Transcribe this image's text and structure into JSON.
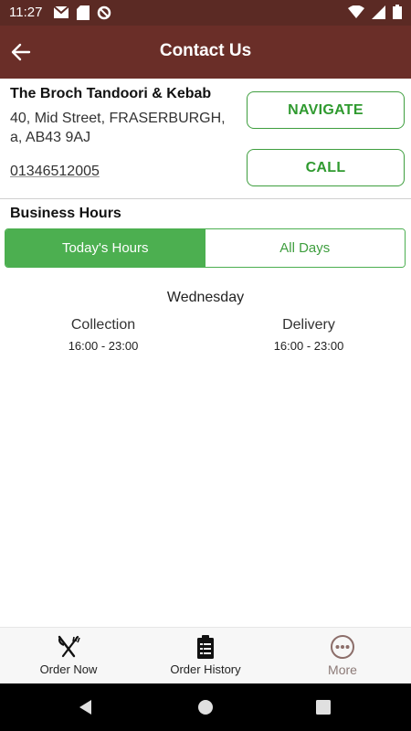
{
  "status_bar": {
    "time": "11:27"
  },
  "app_bar": {
    "title": "Contact Us"
  },
  "restaurant": {
    "name": "The Broch Tandoori & Kebab",
    "address_line1": "40, Mid Street, FRASERBURGH,",
    "address_line2": "a, AB43 9AJ",
    "phone": "01346512005"
  },
  "actions": {
    "navigate": "NAVIGATE",
    "call": "CALL"
  },
  "hours": {
    "heading": "Business Hours",
    "tabs": [
      "Today's Hours",
      "All Days"
    ],
    "day": "Wednesday",
    "collection_label": "Collection",
    "collection_hours": "16:00 - 23:00",
    "delivery_label": "Delivery",
    "delivery_hours": "16:00 - 23:00"
  },
  "bottom_nav": [
    {
      "label": "Order Now",
      "icon": "fork-knife-icon"
    },
    {
      "label": "Order History",
      "icon": "clipboard-icon"
    },
    {
      "label": "More",
      "icon": "more-dots-icon"
    }
  ],
  "colors": {
    "brand": "#6a2e28",
    "accent": "#4caf50"
  }
}
